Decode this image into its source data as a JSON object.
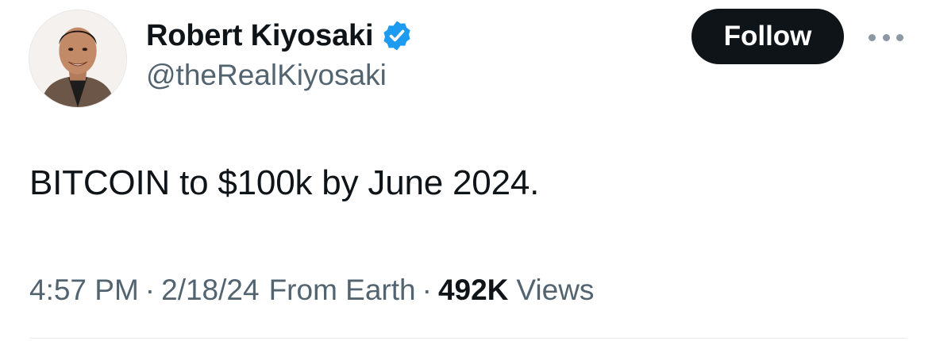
{
  "author": {
    "display_name": "Robert Kiyosaki",
    "handle": "@theRealKiyosaki",
    "verified": true,
    "verified_color": "#1d9bf0"
  },
  "actions": {
    "follow_label": "Follow"
  },
  "tweet": {
    "text": "BITCOIN to $100k by June 2024.",
    "time": "4:57 PM",
    "separator": "·",
    "date": "2/18/24",
    "source": "From Earth",
    "views_count": "492K",
    "views_label": "Views"
  },
  "colors": {
    "text_primary": "#0f1419",
    "text_secondary": "#536471",
    "button_bg": "#0f1419",
    "button_text": "#ffffff"
  },
  "icons": {
    "verified": "verified-badge-icon",
    "more": "more-options-icon"
  }
}
